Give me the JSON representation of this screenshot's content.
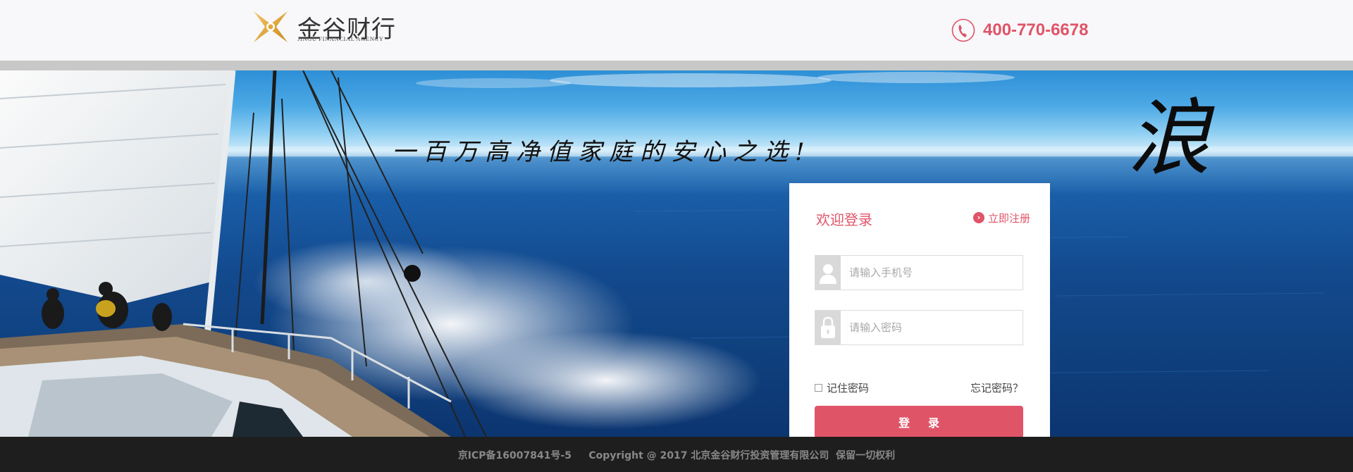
{
  "header": {
    "logo_cn": "金谷财行",
    "logo_en": "JINGU FINANCIAL AGENCY",
    "phone_icon": "phone-icon",
    "phone": "400-770-6678"
  },
  "banner": {
    "slogan": "一百万高净值家庭的安心之选!",
    "calligraphy": "浪"
  },
  "login": {
    "title": "欢迎登录",
    "register_label": "立即注册",
    "register_icon": "arrow-circle-icon",
    "phone_placeholder": "请输入手机号",
    "phone_icon": "user-icon",
    "password_placeholder": "请输入密码",
    "password_icon": "lock-icon",
    "remember_label": "记住密码",
    "forgot_label": "忘记密码？",
    "submit_label": "登录"
  },
  "footer": {
    "text": "京ICP备16007841号-5     Copyright @ 2017 北京金谷财行投资管理有限公司  保留一切权利"
  },
  "colors": {
    "accent": "#e05468",
    "footer_bg": "#1e1e1e",
    "header_bg": "#f8f8fa"
  }
}
